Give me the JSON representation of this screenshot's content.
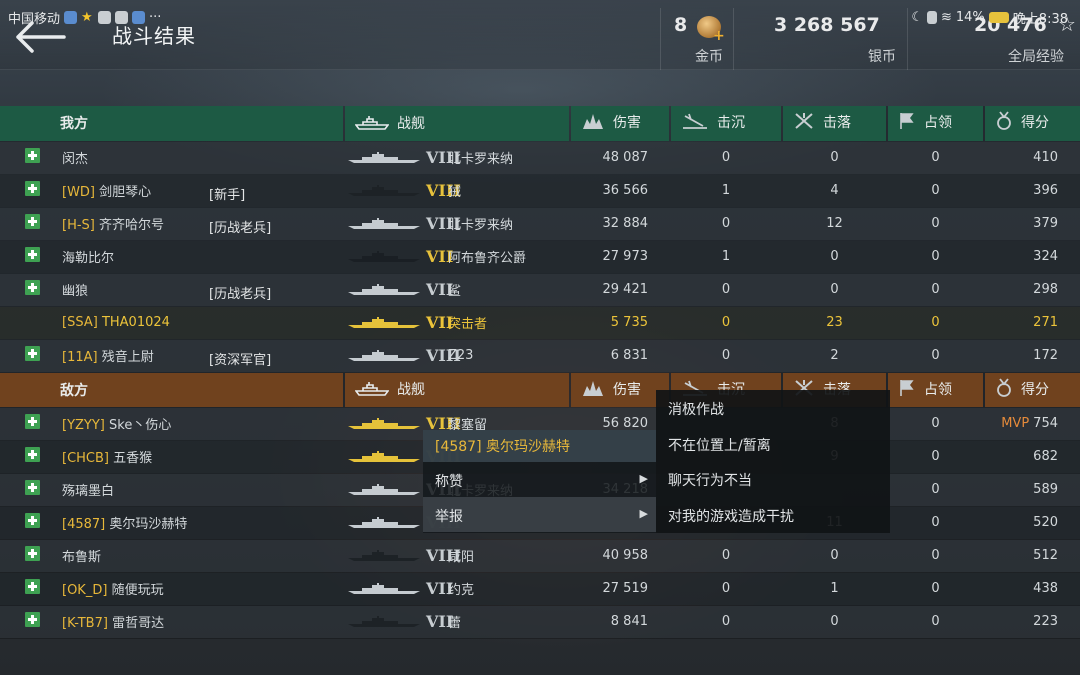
{
  "status_bar": {
    "carrier": "中国移动",
    "battery": "14%",
    "time": "晚上8:38",
    "dots": "···"
  },
  "header": {
    "title": "战斗结果",
    "currencies": [
      {
        "value": "8",
        "label": "金币"
      },
      {
        "value": "3 268 567",
        "label": "银币"
      },
      {
        "value": "20 476",
        "label": "全局经验"
      }
    ]
  },
  "columns": {
    "ship": "战舰",
    "damage": "伤害",
    "sunk": "击沉",
    "shot_down": "击落",
    "capture": "占领",
    "score": "得分"
  },
  "ally": {
    "label": "我方",
    "rows": [
      {
        "clan": "",
        "name": "闵杰",
        "tag": "",
        "tier": "VIII",
        "ship": "北卡罗来纳",
        "damage": "48 087",
        "sunk": "0",
        "shot_down": "0",
        "capture": "0",
        "score": "410",
        "mvp": "",
        "hull": "#c5cbd0"
      },
      {
        "clan": "[WD]",
        "name": "剑胆琴心",
        "tag": "[新手]",
        "tier": "VIII",
        "ship": "狨",
        "damage": "36 566",
        "sunk": "1",
        "shot_down": "4",
        "capture": "0",
        "score": "396",
        "mvp": "",
        "hull": "#1d2226",
        "gold": true
      },
      {
        "clan": "[H-S]",
        "name": "齐齐哈尔号",
        "tag": "[历战老兵]",
        "tier": "VIII",
        "ship": "北卡罗来纳",
        "damage": "32 884",
        "sunk": "0",
        "shot_down": "12",
        "capture": "0",
        "score": "379",
        "mvp": "",
        "hull": "#c5cbd0"
      },
      {
        "clan": "",
        "name": "海勒比尔",
        "tag": "",
        "tier": "VII",
        "ship": "阿布鲁齐公爵",
        "damage": "27 973",
        "sunk": "1",
        "shot_down": "0",
        "capture": "0",
        "score": "324",
        "mvp": "",
        "hull": "#1a1f24",
        "gold": true
      },
      {
        "clan": "",
        "name": "幽狼",
        "tag": "[历战老兵]",
        "tier": "VII",
        "ship": "鲨",
        "damage": "29 421",
        "sunk": "0",
        "shot_down": "0",
        "capture": "0",
        "score": "298",
        "mvp": "",
        "hull": "#c5cbd0"
      },
      {
        "clan": "[SSA]",
        "name": "THA01024",
        "tag": "",
        "tier": "VII",
        "ship": "突击者",
        "damage": "5 735",
        "sunk": "0",
        "shot_down": "23",
        "capture": "0",
        "score": "271",
        "mvp": "",
        "hull": "#e5c23a",
        "me": true
      },
      {
        "clan": "[11A]",
        "name": "残音上尉",
        "tag": "[资深军官]",
        "tier": "VIII",
        "ship": "Z23",
        "damage": "6 831",
        "sunk": "0",
        "shot_down": "2",
        "capture": "0",
        "score": "172",
        "mvp": "",
        "hull": "#c5cbd0"
      }
    ]
  },
  "enemy": {
    "label": "敌方",
    "rows": [
      {
        "clan": "[YZYY]",
        "name": "Ske丶伤心",
        "tag": "",
        "tier": "VIII",
        "ship": "黎塞留",
        "damage": "56 820",
        "sunk": "",
        "shot_down": "8",
        "capture": "0",
        "score": "754",
        "mvp": "MVP",
        "hull": "#e5c23a",
        "gold": true
      },
      {
        "clan": "[CHCB]",
        "name": "五香猴",
        "tag": "",
        "tier": "VIII",
        "ship": "",
        "damage": "",
        "sunk": "",
        "shot_down": "9",
        "capture": "0",
        "score": "682",
        "mvp": "",
        "hull": "#e5c23a",
        "gold": true
      },
      {
        "clan": "",
        "name": "殇璃墨白",
        "tag": "",
        "tier": "VIII",
        "ship": "北卡罗来纳",
        "damage": "34 218",
        "sunk": "",
        "shot_down": "",
        "capture": "0",
        "score": "589",
        "mvp": "",
        "hull": "#c5cbd0"
      },
      {
        "clan": "[4587]",
        "name": "奥尔玛沙赫特",
        "tag": "",
        "tier": "VIII",
        "ship": "",
        "damage": "",
        "sunk": "",
        "shot_down": "11",
        "capture": "0",
        "score": "520",
        "mvp": "",
        "hull": "#c5cbd0"
      },
      {
        "clan": "",
        "name": "布鲁斯",
        "tag": "",
        "tier": "VIII",
        "ship": "咸阳",
        "damage": "40 958",
        "sunk": "0",
        "shot_down": "0",
        "capture": "0",
        "score": "512",
        "mvp": "",
        "hull": "#1d2226"
      },
      {
        "clan": "[OK_D]",
        "name": "随便玩玩",
        "tag": "",
        "tier": "VII",
        "ship": "约克",
        "damage": "27 519",
        "sunk": "0",
        "shot_down": "1",
        "capture": "0",
        "score": "438",
        "mvp": "",
        "hull": "#c5cbd0"
      },
      {
        "clan": "[K-TB7]",
        "name": "雷哲哥达",
        "tag": "",
        "tier": "VII",
        "ship": "蕾",
        "damage": "8 841",
        "sunk": "0",
        "shot_down": "0",
        "capture": "0",
        "score": "223",
        "mvp": "",
        "hull": "#1d2226"
      }
    ]
  },
  "context_menu": {
    "player": "[4587] 奥尔玛沙赫特",
    "items": [
      "称赞",
      "举报"
    ],
    "submenu": [
      "消极作战",
      "不在位置上/暂离",
      "聊天行为不当",
      "对我的游戏造成干扰"
    ]
  },
  "colors": {
    "ally_header": "#1d5a44",
    "enemy_header": "#70421e",
    "add_button": "#3ea152",
    "clan": "#e8b83a",
    "mvp": "#e58a3a"
  }
}
